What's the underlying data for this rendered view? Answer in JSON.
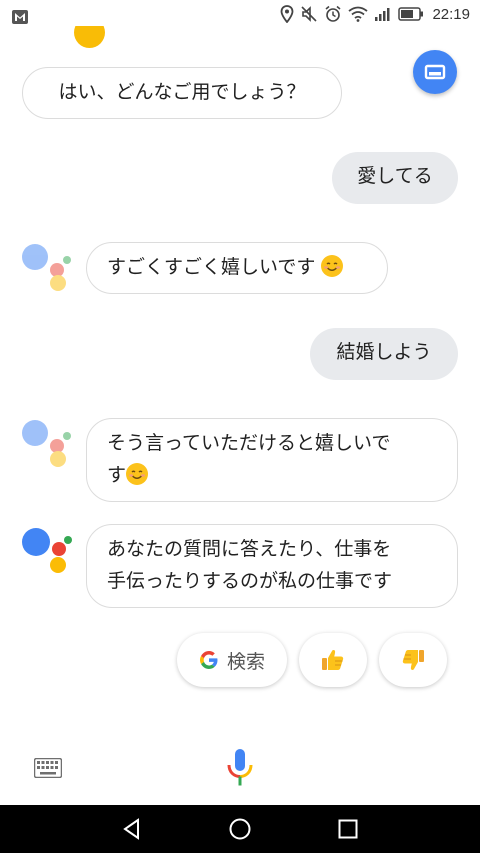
{
  "status_bar": {
    "time": "22:19",
    "icons": [
      "gmail-icon",
      "location-icon",
      "mute-icon",
      "alarm-icon",
      "wifi-icon",
      "signal-icon",
      "battery-icon"
    ]
  },
  "conversation": [
    {
      "role": "assistant",
      "text": "はい、どんなご用でしょう？"
    },
    {
      "role": "user",
      "text": "愛してる"
    },
    {
      "role": "assistant",
      "text": "すごくすごく嬉しいです",
      "emoji": "smiling-face"
    },
    {
      "role": "user",
      "text": "結婚しよう"
    },
    {
      "role": "assistant",
      "text_line1": "そう言っていただけると嬉しいで",
      "text_line2": "す",
      "emoji": "smiling-face"
    },
    {
      "role": "assistant",
      "text_line1": "あなたの質問に答えたり、仕事を",
      "text_line2": "手伝ったりするのが私の仕事です"
    }
  ],
  "suggestion_chips": {
    "search_label": "検索",
    "thumbs_up": "thumbs-up-icon",
    "thumbs_down": "thumbs-down-icon"
  },
  "bottom_bar": {
    "keyboard": "keyboard-icon",
    "mic": "mic-icon"
  },
  "colors": {
    "google_blue": "#4285f4",
    "google_red": "#ea4335",
    "google_yellow": "#fbbc05",
    "google_green": "#34a853",
    "user_bubble": "#e8eaed"
  }
}
